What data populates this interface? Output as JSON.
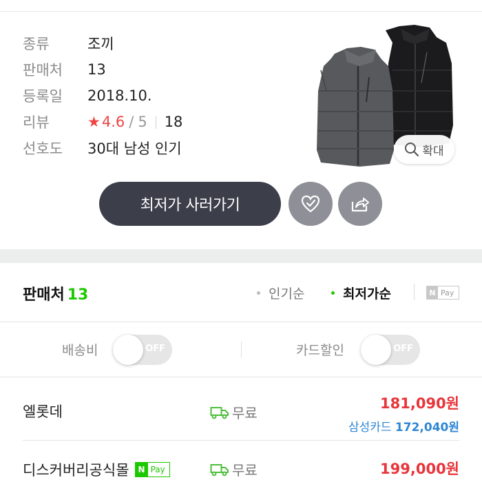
{
  "product_info": {
    "rows": [
      {
        "label": "종류",
        "value": "조끼"
      },
      {
        "label": "판매처",
        "value": "13"
      },
      {
        "label": "등록일",
        "value": "2018.10."
      },
      {
        "label": "리뷰",
        "value": ""
      },
      {
        "label": "선호도",
        "value": "30대 남성 인기"
      }
    ],
    "review": {
      "star": "★",
      "rating": "4.6",
      "slash": "/",
      "max": "5",
      "count": "18"
    }
  },
  "image": {
    "zoom_label": "확대",
    "icon": "magnifier-icon"
  },
  "actions": {
    "buy_label": "최저가 사러가기",
    "like_icon": "heart-check-icon",
    "share_icon": "share-icon"
  },
  "sellers": {
    "title": "판매처",
    "count": "13",
    "sort_popular": "인기순",
    "sort_lowest": "최저가순",
    "npay_n": "N",
    "npay_label": "Pay",
    "filters": [
      {
        "label": "배송비",
        "state": "OFF"
      },
      {
        "label": "카드할인",
        "state": "OFF"
      }
    ],
    "list": [
      {
        "name": "엘롯데",
        "npay": false,
        "delivery": "무료",
        "price": "181,090원",
        "card_name": "삼성카드",
        "card_price": "172,040원"
      },
      {
        "name": "디스커버리공식몰",
        "npay": true,
        "delivery": "무료",
        "price": "199,000원"
      }
    ]
  },
  "colors": {
    "accent_green": "#1ec800",
    "price_red": "#e8353b",
    "card_blue": "#2f86d4",
    "button_dark": "#3c3f4a",
    "button_gray": "#8e8f97"
  }
}
